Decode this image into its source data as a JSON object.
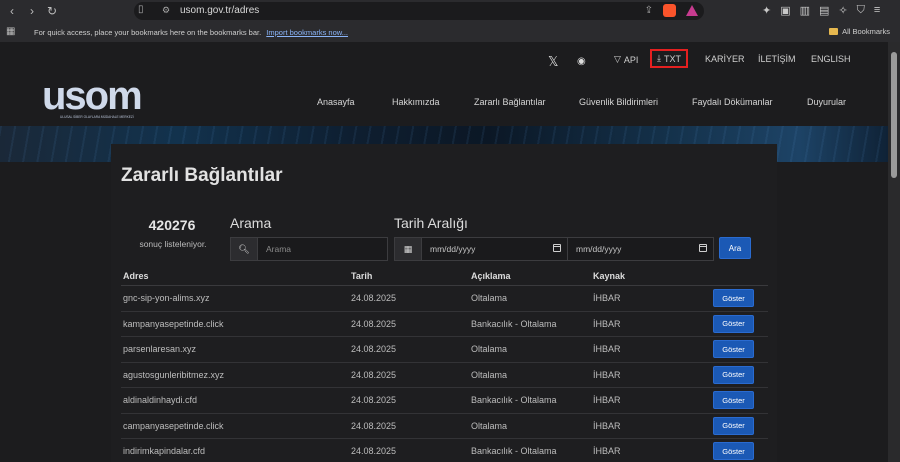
{
  "browser": {
    "url": "usom.gov.tr/adres",
    "bookmarks_hint": "For quick access, place your bookmarks here on the bookmarks bar.",
    "bookmarks_link": "Import bookmarks now...",
    "all_bookmarks": "All Bookmarks"
  },
  "topnav": {
    "api": "API",
    "txt": "TXT",
    "kariyer": "KARİYER",
    "iletisim": "İLETİŞİM",
    "english": "ENGLISH"
  },
  "logo": {
    "text": "usom",
    "subtitle": "ULUSAL SİBER OLAYLARA MÜDAHALE MERKEZİ"
  },
  "mainnav": [
    "Anasayfa",
    "Hakkımızda",
    "Zararlı Bağlantılar",
    "Güvenlik Bildirimleri",
    "Faydalı Dökümanlar",
    "Duyurular"
  ],
  "page": {
    "title": "Zararlı Bağlantılar",
    "count": "420276",
    "count_sub": "sonuç listeleniyor.",
    "search_label": "Arama",
    "search_placeholder": "Arama",
    "date_label": "Tarih Aralığı",
    "date_from_placeholder": "mm/dd/yyyy",
    "date_to_placeholder": "mm/dd/yyyy",
    "search_button": "Ara"
  },
  "table": {
    "headers": [
      "Adres",
      "Tarih",
      "Açıklama",
      "Kaynak"
    ],
    "button_label": "Göster",
    "rows": [
      [
        "gnc-sip-yon-alims.xyz",
        "24.08.2025",
        "Oltalama",
        "İHBAR"
      ],
      [
        "kampanyasepetinde.click",
        "24.08.2025",
        "Bankacılık - Oltalama",
        "İHBAR"
      ],
      [
        "parsenlaresan.xyz",
        "24.08.2025",
        "Oltalama",
        "İHBAR"
      ],
      [
        "agustosgunleribitmez.xyz",
        "24.08.2025",
        "Oltalama",
        "İHBAR"
      ],
      [
        "aldinaldinhaydi.cfd",
        "24.08.2025",
        "Bankacılık - Oltalama",
        "İHBAR"
      ],
      [
        "campanyasepetinde.click",
        "24.08.2025",
        "Oltalama",
        "İHBAR"
      ],
      [
        "indirimkapindalar.cfd",
        "24.08.2025",
        "Bankacılık - Oltalama",
        "İHBAR"
      ]
    ]
  }
}
